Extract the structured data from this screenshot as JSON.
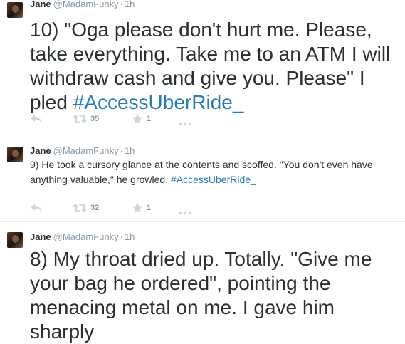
{
  "tweets": [
    {
      "name": "Jane",
      "handle": "@MadamFunky",
      "dot": "·",
      "time": "1h",
      "text": "10) \"Oga please don't hurt me. Please, take everything. Take me to an ATM I will withdraw cash and give you. Please\" I pled ",
      "hashtag": "#AccessUberRide_",
      "retweets": "35",
      "favorites": "1"
    },
    {
      "name": "Jane",
      "handle": "@MadamFunky",
      "dot": "·",
      "time": "1h",
      "text": "9) He took a cursory glance at the contents and scoffed. \"You don't even have anything valuable,\" he growled. ",
      "hashtag": "#AccessUberRide_",
      "retweets": "32",
      "favorites": "1"
    },
    {
      "name": "Jane",
      "handle": "@MadamFunky",
      "dot": "·",
      "time": "1h",
      "text": "8) My throat dried up. Totally. \"Give me your bag he ordered\", pointing the menacing metal on me. I gave him sharply"
    }
  ],
  "icons": {
    "reply": "reply-icon",
    "retweet": "retweet-icon",
    "favorite": "star-icon",
    "more": "more-dots-icon"
  },
  "colors": {
    "text": "#292f33",
    "muted": "#8899a6",
    "hashtag": "#2b7bb9",
    "icon": "#ccd6dd",
    "divider": "#e1e8ed"
  }
}
